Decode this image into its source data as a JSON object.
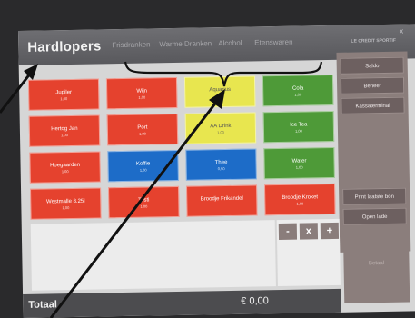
{
  "header": {
    "title": "Hardlopers",
    "categories": [
      "Frisdranken",
      "Warme Dranken",
      "Alcohol",
      "Etenswaren"
    ],
    "right_title": "LE CREDIT SPORTIF",
    "close": "x"
  },
  "products": [
    {
      "name": "Jupiler",
      "price": "1,00",
      "color": "#e5422e"
    },
    {
      "name": "Wijn",
      "price": "1,00",
      "color": "#e5422e"
    },
    {
      "name": "Aquarius",
      "price": "1,00",
      "color": "#e8e64f"
    },
    {
      "name": "Cola",
      "price": "1,00",
      "color": "#4e9a38"
    },
    {
      "name": "Hertog Jan",
      "price": "1,00",
      "color": "#e5422e"
    },
    {
      "name": "Port",
      "price": "1,00",
      "color": "#e5422e"
    },
    {
      "name": "AA Drink",
      "price": "1,00",
      "color": "#e8e64f"
    },
    {
      "name": "Ice Tea",
      "price": "1,00",
      "color": "#4e9a38"
    },
    {
      "name": "Hoegaarden",
      "price": "1,00",
      "color": "#e5422e"
    },
    {
      "name": "Koffie",
      "price": "1,00",
      "color": "#1d6cc8"
    },
    {
      "name": "Thee",
      "price": "0,50",
      "color": "#1d6cc8"
    },
    {
      "name": "Water",
      "price": "1,00",
      "color": "#4e9a38"
    },
    {
      "name": "Westmalle 8.25l",
      "price": "1,00",
      "color": "#e5422e"
    },
    {
      "name": "Tosti",
      "price": "1,00",
      "color": "#e5422e"
    },
    {
      "name": "Broodje Frikandel",
      "price": "",
      "color": "#e5422e"
    },
    {
      "name": "Broodje Kroket",
      "price": "1,00",
      "color": "#e5422e"
    }
  ],
  "side_buttons": {
    "saldo": "Saldo",
    "beheer": "Beheer",
    "kassaterminal": "Kassaterminal",
    "print": "Print laatste bon",
    "open_lade": "Open lade"
  },
  "controls": {
    "minus": "-",
    "remove": "x",
    "plus": "+"
  },
  "pay_label": "Betaal",
  "footer": {
    "total_label": "Totaal",
    "total_value": "€ 0,00"
  }
}
